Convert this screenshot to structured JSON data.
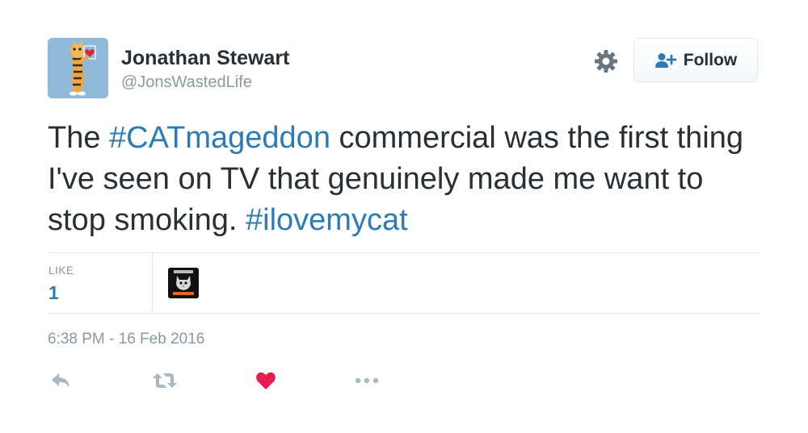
{
  "author": {
    "name": "Jonathan Stewart",
    "handle": "@JonsWastedLife",
    "avatar_icon": "tiger-cartoon-avatar"
  },
  "header": {
    "settings_icon": "gear-icon",
    "follow_label": "Follow",
    "follow_icon": "add-user-icon"
  },
  "tweet": {
    "segments": {
      "s1": "The ",
      "s2": "#CATmageddon",
      "s3": " commercial was the first thing I've seen on TV that genuinely made me want to stop smoking. ",
      "s4": "#ilovemycat"
    }
  },
  "stats": {
    "like_label": "LIKE",
    "like_count": "1",
    "liker_avatar_icon": "catmageddon-avatar"
  },
  "timestamp": "6:38 PM - 16 Feb 2016",
  "actions": {
    "reply_icon": "reply-icon",
    "retweet_icon": "retweet-icon",
    "like_icon": "heart-icon",
    "more_icon": "more-icon"
  },
  "colors": {
    "text": "#292f33",
    "muted": "#8899a6",
    "link": "#2b7bb9",
    "heart": "#e81c4f",
    "border": "#e1e8ed"
  }
}
